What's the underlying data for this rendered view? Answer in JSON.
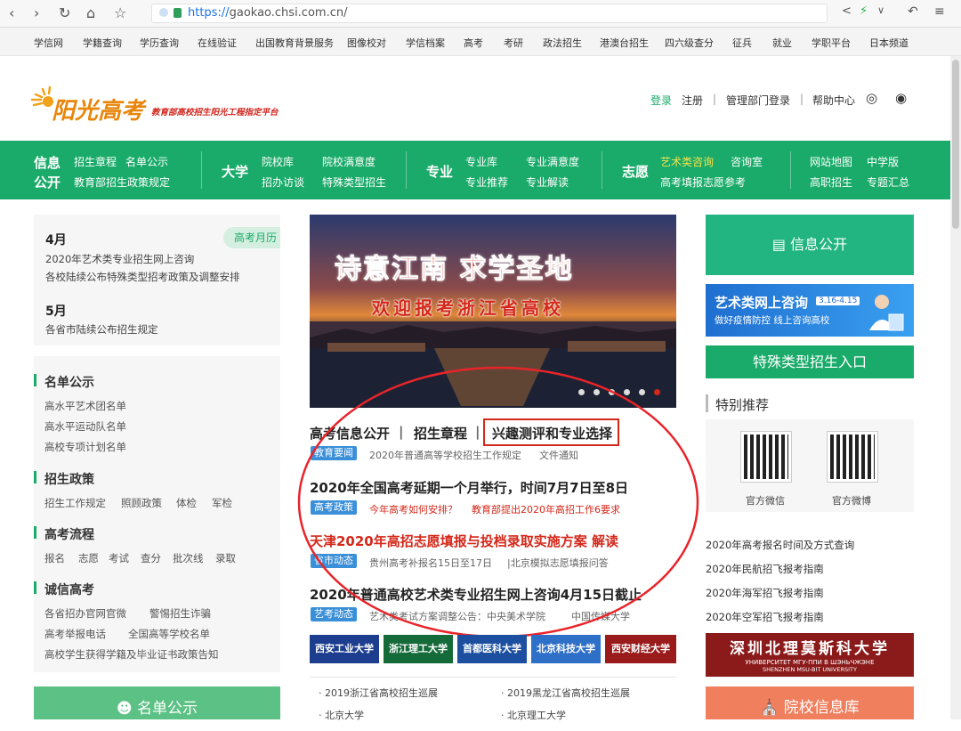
{
  "browser": {
    "url_prefix": "https://",
    "url_host": "gaokao.chsi.com.cn/"
  },
  "toplinks": [
    "学信网",
    "学籍查询",
    "学历查询",
    "在线验证",
    "出国教育背景服务",
    "图像校对",
    "学信档案",
    "高考",
    "考研",
    "政法招生",
    "港澳台招生",
    "四六级查分",
    "征兵",
    "就业",
    "学职平台",
    "日本频道"
  ],
  "header": {
    "logo_text": "阳光高考",
    "logo_sub": "教育部高校招生阳光工程指定平台",
    "login": "登录",
    "register": "注册",
    "admin_login": "管理部门登录",
    "help": "帮助中心"
  },
  "nav": {
    "info_line1": "信息",
    "info_line2": "公开",
    "info_items": [
      "招生章程",
      "名单公示",
      "教育部招生政策规定"
    ],
    "univ": "大学",
    "univ_items": [
      "院校库",
      "院校满意度",
      "招办访谈",
      "特殊类型招生"
    ],
    "major": "专业",
    "major_items": [
      "专业库",
      "专业满意度",
      "专业推荐",
      "专业解读"
    ],
    "wish": "志愿",
    "wish_items": [
      "艺术类咨询",
      "咨询室",
      "高考填报志愿参考"
    ],
    "other_items": [
      "网站地图",
      "中学版",
      "高职招生",
      "专题汇总"
    ]
  },
  "calendar": {
    "badge": "高考月历",
    "m1": "4月",
    "m1_items": [
      "2020年艺术类专业招生网上咨询",
      "各校陆续公布特殊类型招考政策及调整安排"
    ],
    "m2": "5月",
    "m2_items": [
      "各省市陆续公布招生规定"
    ]
  },
  "sections": [
    {
      "title": "名单公示",
      "items": [
        "高水平艺术团名单",
        "高水平运动队名单",
        "高校专项计划名单"
      ]
    },
    {
      "title": "招生政策",
      "items": [
        "招生工作规定",
        "照顾政策",
        "体检",
        "军检"
      ]
    },
    {
      "title": "高考流程",
      "items": [
        "报名",
        "志愿",
        "考试",
        "查分",
        "批次线",
        "录取"
      ]
    },
    {
      "title": "诚信高考",
      "items": [
        "各省招办官网官微",
        "警惕招生诈骗",
        "高考举报电话",
        "全国高等学校名单",
        "高校学生获得学籍及毕业证书政策告知"
      ]
    }
  ],
  "left_button": "名单公示",
  "banner": {
    "line1": "诗意江南  求学圣地",
    "line2": "欢迎报考浙江省高校"
  },
  "tabs": {
    "t1": "高考信息公开",
    "t2": "招生章程",
    "t3": "兴趣测评和专业选择"
  },
  "news": [
    {
      "tag": "教育要闻",
      "text": "2020年普通高等学校招生工作规定",
      "text2": "文件通知"
    },
    {
      "headline": "2020年全国高考延期一个月举行，时间7月7日至8日",
      "tag": "高考政策",
      "text": "今年高考如何安排？",
      "text2": "教育部提出2020年高招工作6要求"
    },
    {
      "headline": "天津2020年高招志愿填报与投档录取实施方案 解读",
      "tag": "省市动态",
      "text": "贵州高考补报名15日至17日",
      "text2": "|北京模拟志愿填报问答"
    },
    {
      "headline": "2020年普通高校艺术类专业招生网上咨询4月15日截止",
      "tag": "艺考动态",
      "text": "艺术类考试方案调整公告：中央美术学院",
      "text2": "中国传媒大学"
    }
  ],
  "universities": [
    "西安工业大学",
    "浙江理工大学",
    "首都医科大学",
    "北京科技大学",
    "西安财经大学"
  ],
  "bottom_links": [
    "2019浙江省高校招生巡展",
    "2019黑龙江省高校招生巡展",
    "北京大学",
    "北京理工大学"
  ],
  "right": {
    "info_public": "信息公开",
    "art_consult_title": "艺术类网上咨询",
    "art_consult_date": "3.16-4.15",
    "art_consult_sub": "做好疫情防控 线上咨询高校",
    "special_entry": "特殊类型招生入口",
    "recommend_title": "特别推荐",
    "qr1": "官方微信",
    "qr2": "官方微博",
    "links": [
      "2020年高考报名时间及方式查询",
      "2020年民航招飞报考指南",
      "2020年海军招飞报考指南",
      "2020年空军招飞报考指南"
    ],
    "shenzhen_cn": "深圳北理莫斯科大学",
    "shenzhen_ru": "УНИВЕРСИТЕТ МГУ-ППИ В ШЭНЬЧЖЭНЕ",
    "shenzhen_en": "SHENZHEN MSU-BIT UNIVERSITY",
    "school_db": "院校信息库"
  },
  "colors": {
    "green": "#1aab6a",
    "red": "#d4281a",
    "blue": "#3a8fd9"
  }
}
